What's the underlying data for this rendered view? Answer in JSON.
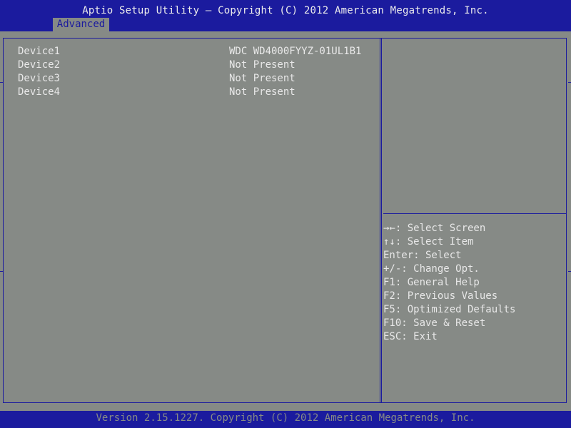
{
  "header": {
    "title": "Aptio Setup Utility – Copyright (C) 2012 American Megatrends, Inc.",
    "tab_label": "Advanced"
  },
  "devices": [
    {
      "label": "Device1",
      "value": "WDC WD4000FYYZ-01UL1B1"
    },
    {
      "label": "Device2",
      "value": "Not Present"
    },
    {
      "label": "Device3",
      "value": "Not Present"
    },
    {
      "label": "Device4",
      "value": "Not Present"
    }
  ],
  "help": [
    "→←: Select Screen",
    "↑↓: Select Item",
    "Enter: Select",
    "+/-: Change Opt.",
    "F1: General Help",
    "F2: Previous Values",
    "F5: Optimized Defaults",
    "F10: Save & Reset",
    "ESC: Exit"
  ],
  "footer": {
    "text": "Version 2.15.1227. Copyright (C) 2012 American Megatrends, Inc."
  },
  "colors": {
    "bar_blue": "#1b1b9e",
    "panel_gray": "#868a86",
    "text_light": "#e8e8e8"
  }
}
